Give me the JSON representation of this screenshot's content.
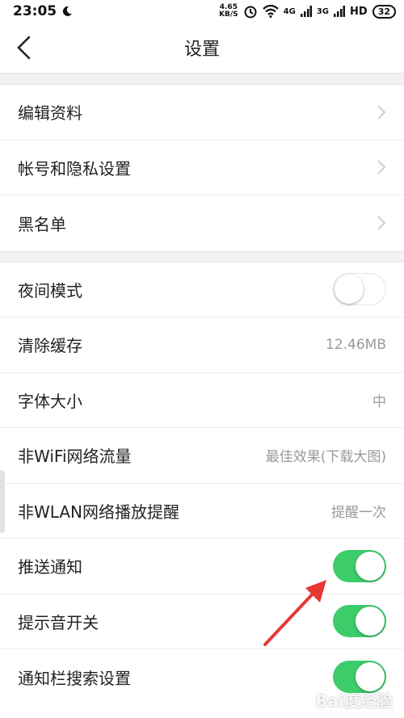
{
  "status_bar": {
    "time": "23:05",
    "net_speed_value": "4.65",
    "net_speed_unit": "KB/S",
    "signal_1_label": "4G",
    "signal_2_label": "3G",
    "hd_label": "HD",
    "battery": "32"
  },
  "nav": {
    "title": "设置"
  },
  "group1": [
    {
      "label": "编辑资料"
    },
    {
      "label": "帐号和隐私设置"
    },
    {
      "label": "黑名单"
    }
  ],
  "group2": {
    "night_mode": {
      "label": "夜间模式",
      "on": false
    },
    "clear_cache": {
      "label": "清除缓存",
      "value": "12.46MB"
    },
    "font_size": {
      "label": "字体大小",
      "value": "中"
    },
    "non_wifi_traffic": {
      "label": "非WiFi网络流量",
      "value": "最佳效果(下载大图)"
    },
    "non_wlan_reminder": {
      "label": "非WLAN网络播放提醒",
      "value": "提醒一次"
    },
    "push_notify": {
      "label": "推送通知",
      "on": true
    },
    "sound_switch": {
      "label": "提示音开关",
      "on": true
    },
    "notify_search": {
      "label": "通知栏搜索设置",
      "on": true
    }
  },
  "colors": {
    "toggle_on": "#3ccd6a",
    "annotation_arrow": "#e53935"
  },
  "icons": {
    "back": "chevron-left-icon",
    "row_arrow": "chevron-right-icon"
  },
  "watermark": "Bai度经验"
}
